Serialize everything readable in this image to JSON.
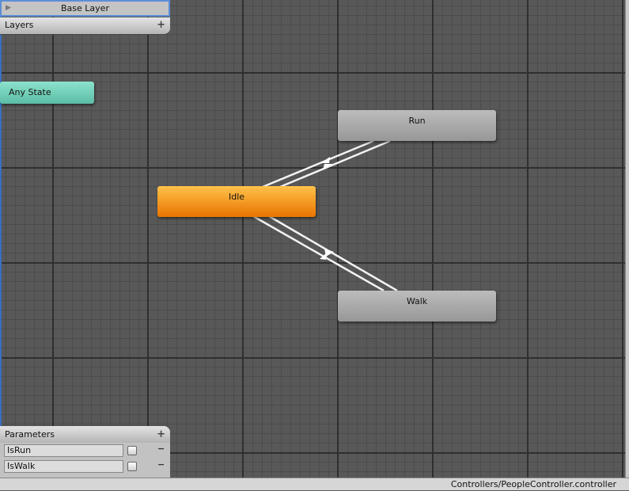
{
  "layers": {
    "current_layer": "Base Layer",
    "panel_title": "Layers",
    "add_icon": "plus-icon"
  },
  "states": {
    "any_state": "Any State",
    "idle": "Idle",
    "run": "Run",
    "walk": "Walk"
  },
  "colors": {
    "default_state": "#f08a00",
    "any_state": "#6fd0b8",
    "state": "#aaaaaa"
  },
  "parameters": {
    "title": "Parameters",
    "items": [
      {
        "name": "IsRun",
        "type": "bool",
        "value": false
      },
      {
        "name": "IsWalk",
        "type": "bool",
        "value": false
      }
    ]
  },
  "status_bar": {
    "path": "Controllers/PeopleController.controller"
  }
}
